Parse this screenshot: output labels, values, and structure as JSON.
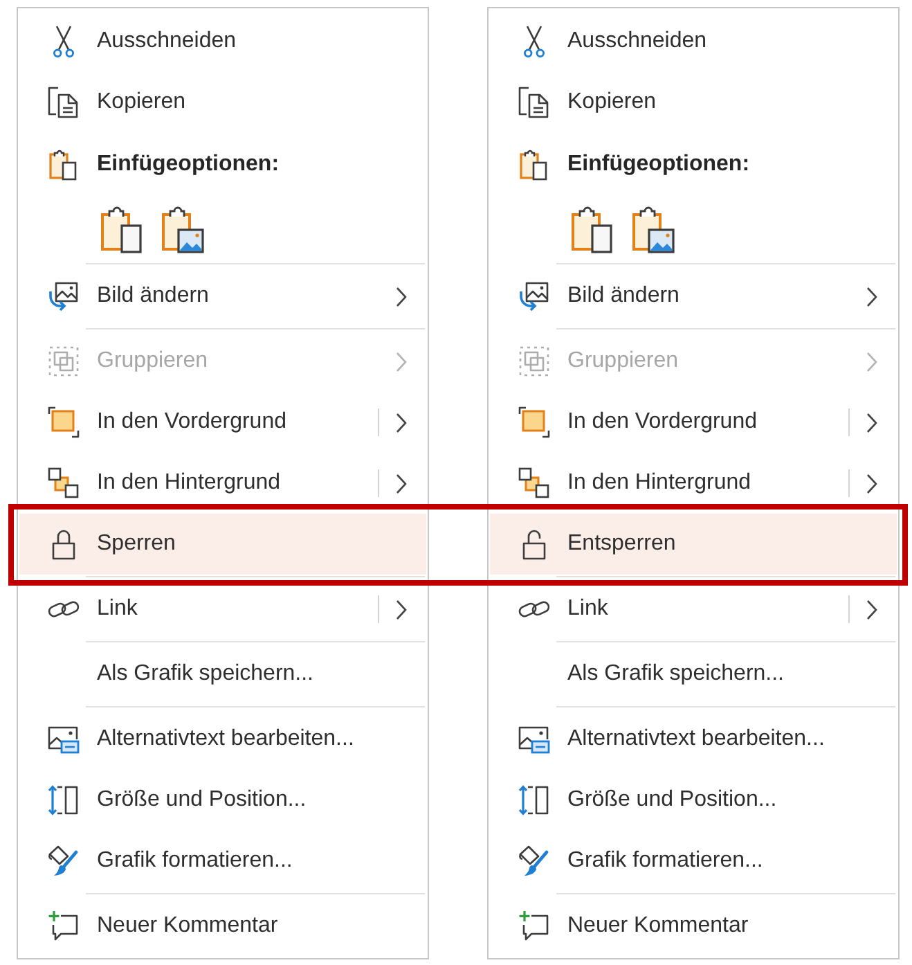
{
  "menus": [
    {
      "groups": [
        {
          "items": [
            {
              "kind": "command",
              "label": "Ausschneiden",
              "selected": false,
              "disabled": false,
              "submenu": false
            },
            {
              "kind": "command",
              "label": "Kopieren",
              "selected": false,
              "disabled": false,
              "submenu": false
            },
            {
              "kind": "heading",
              "label": "Einfügeoptionen:"
            },
            {
              "kind": "paste_options"
            }
          ]
        },
        {
          "items": [
            {
              "kind": "command",
              "label": "Bild ändern",
              "selected": false,
              "disabled": false,
              "submenu": true,
              "split": false
            }
          ]
        },
        {
          "items": [
            {
              "kind": "command",
              "label": "Gruppieren",
              "selected": false,
              "disabled": true,
              "submenu": true,
              "split": false
            },
            {
              "kind": "command",
              "label": "In den Vordergrund",
              "selected": false,
              "disabled": false,
              "submenu": true,
              "split": true
            },
            {
              "kind": "command",
              "label": "In den Hintergrund",
              "selected": false,
              "disabled": false,
              "submenu": true,
              "split": true
            },
            {
              "kind": "lock",
              "label": "Sperren",
              "selected": true,
              "disabled": false,
              "submenu": false
            }
          ]
        },
        {
          "items": [
            {
              "kind": "command",
              "label": "Link",
              "selected": false,
              "disabled": false,
              "submenu": true,
              "split": true
            }
          ]
        },
        {
          "items": [
            {
              "kind": "command",
              "label": "Als Grafik speichern...",
              "selected": false,
              "disabled": false,
              "submenu": false
            }
          ]
        },
        {
          "items": [
            {
              "kind": "command",
              "label": "Alternativtext bearbeiten...",
              "selected": false,
              "disabled": false,
              "submenu": false
            },
            {
              "kind": "command",
              "label": "Größe und Position...",
              "selected": false,
              "disabled": false,
              "submenu": false
            },
            {
              "kind": "command",
              "label": "Grafik formatieren...",
              "selected": false,
              "disabled": false,
              "submenu": false
            }
          ]
        },
        {
          "items": [
            {
              "kind": "command",
              "label": "Neuer Kommentar",
              "selected": false,
              "disabled": false,
              "submenu": false
            }
          ]
        }
      ]
    },
    {
      "groups": [
        {
          "items": [
            {
              "kind": "command",
              "label": "Ausschneiden",
              "selected": false,
              "disabled": false,
              "submenu": false
            },
            {
              "kind": "command",
              "label": "Kopieren",
              "selected": false,
              "disabled": false,
              "submenu": false
            },
            {
              "kind": "heading",
              "label": "Einfügeoptionen:"
            },
            {
              "kind": "paste_options"
            }
          ]
        },
        {
          "items": [
            {
              "kind": "command",
              "label": "Bild ändern",
              "selected": false,
              "disabled": false,
              "submenu": true,
              "split": false
            }
          ]
        },
        {
          "items": [
            {
              "kind": "command",
              "label": "Gruppieren",
              "selected": false,
              "disabled": true,
              "submenu": true,
              "split": false
            },
            {
              "kind": "command",
              "label": "In den Vordergrund",
              "selected": false,
              "disabled": false,
              "submenu": true,
              "split": true
            },
            {
              "kind": "command",
              "label": "In den Hintergrund",
              "selected": false,
              "disabled": false,
              "submenu": true,
              "split": true
            },
            {
              "kind": "unlock",
              "label": "Entsperren",
              "selected": true,
              "disabled": false,
              "submenu": false
            }
          ]
        },
        {
          "items": [
            {
              "kind": "command",
              "label": "Link",
              "selected": false,
              "disabled": false,
              "submenu": true,
              "split": true
            }
          ]
        },
        {
          "items": [
            {
              "kind": "command",
              "label": "Als Grafik speichern...",
              "selected": false,
              "disabled": false,
              "submenu": false
            }
          ]
        },
        {
          "items": [
            {
              "kind": "command",
              "label": "Alternativtext bearbeiten...",
              "selected": false,
              "disabled": false,
              "submenu": false
            },
            {
              "kind": "command",
              "label": "Größe und Position...",
              "selected": false,
              "disabled": false,
              "submenu": false
            },
            {
              "kind": "command",
              "label": "Grafik formatieren...",
              "selected": false,
              "disabled": false,
              "submenu": false
            }
          ]
        },
        {
          "items": [
            {
              "kind": "command",
              "label": "Neuer Kommentar",
              "selected": false,
              "disabled": false,
              "submenu": false
            }
          ]
        }
      ]
    }
  ],
  "highlight_frame": true
}
